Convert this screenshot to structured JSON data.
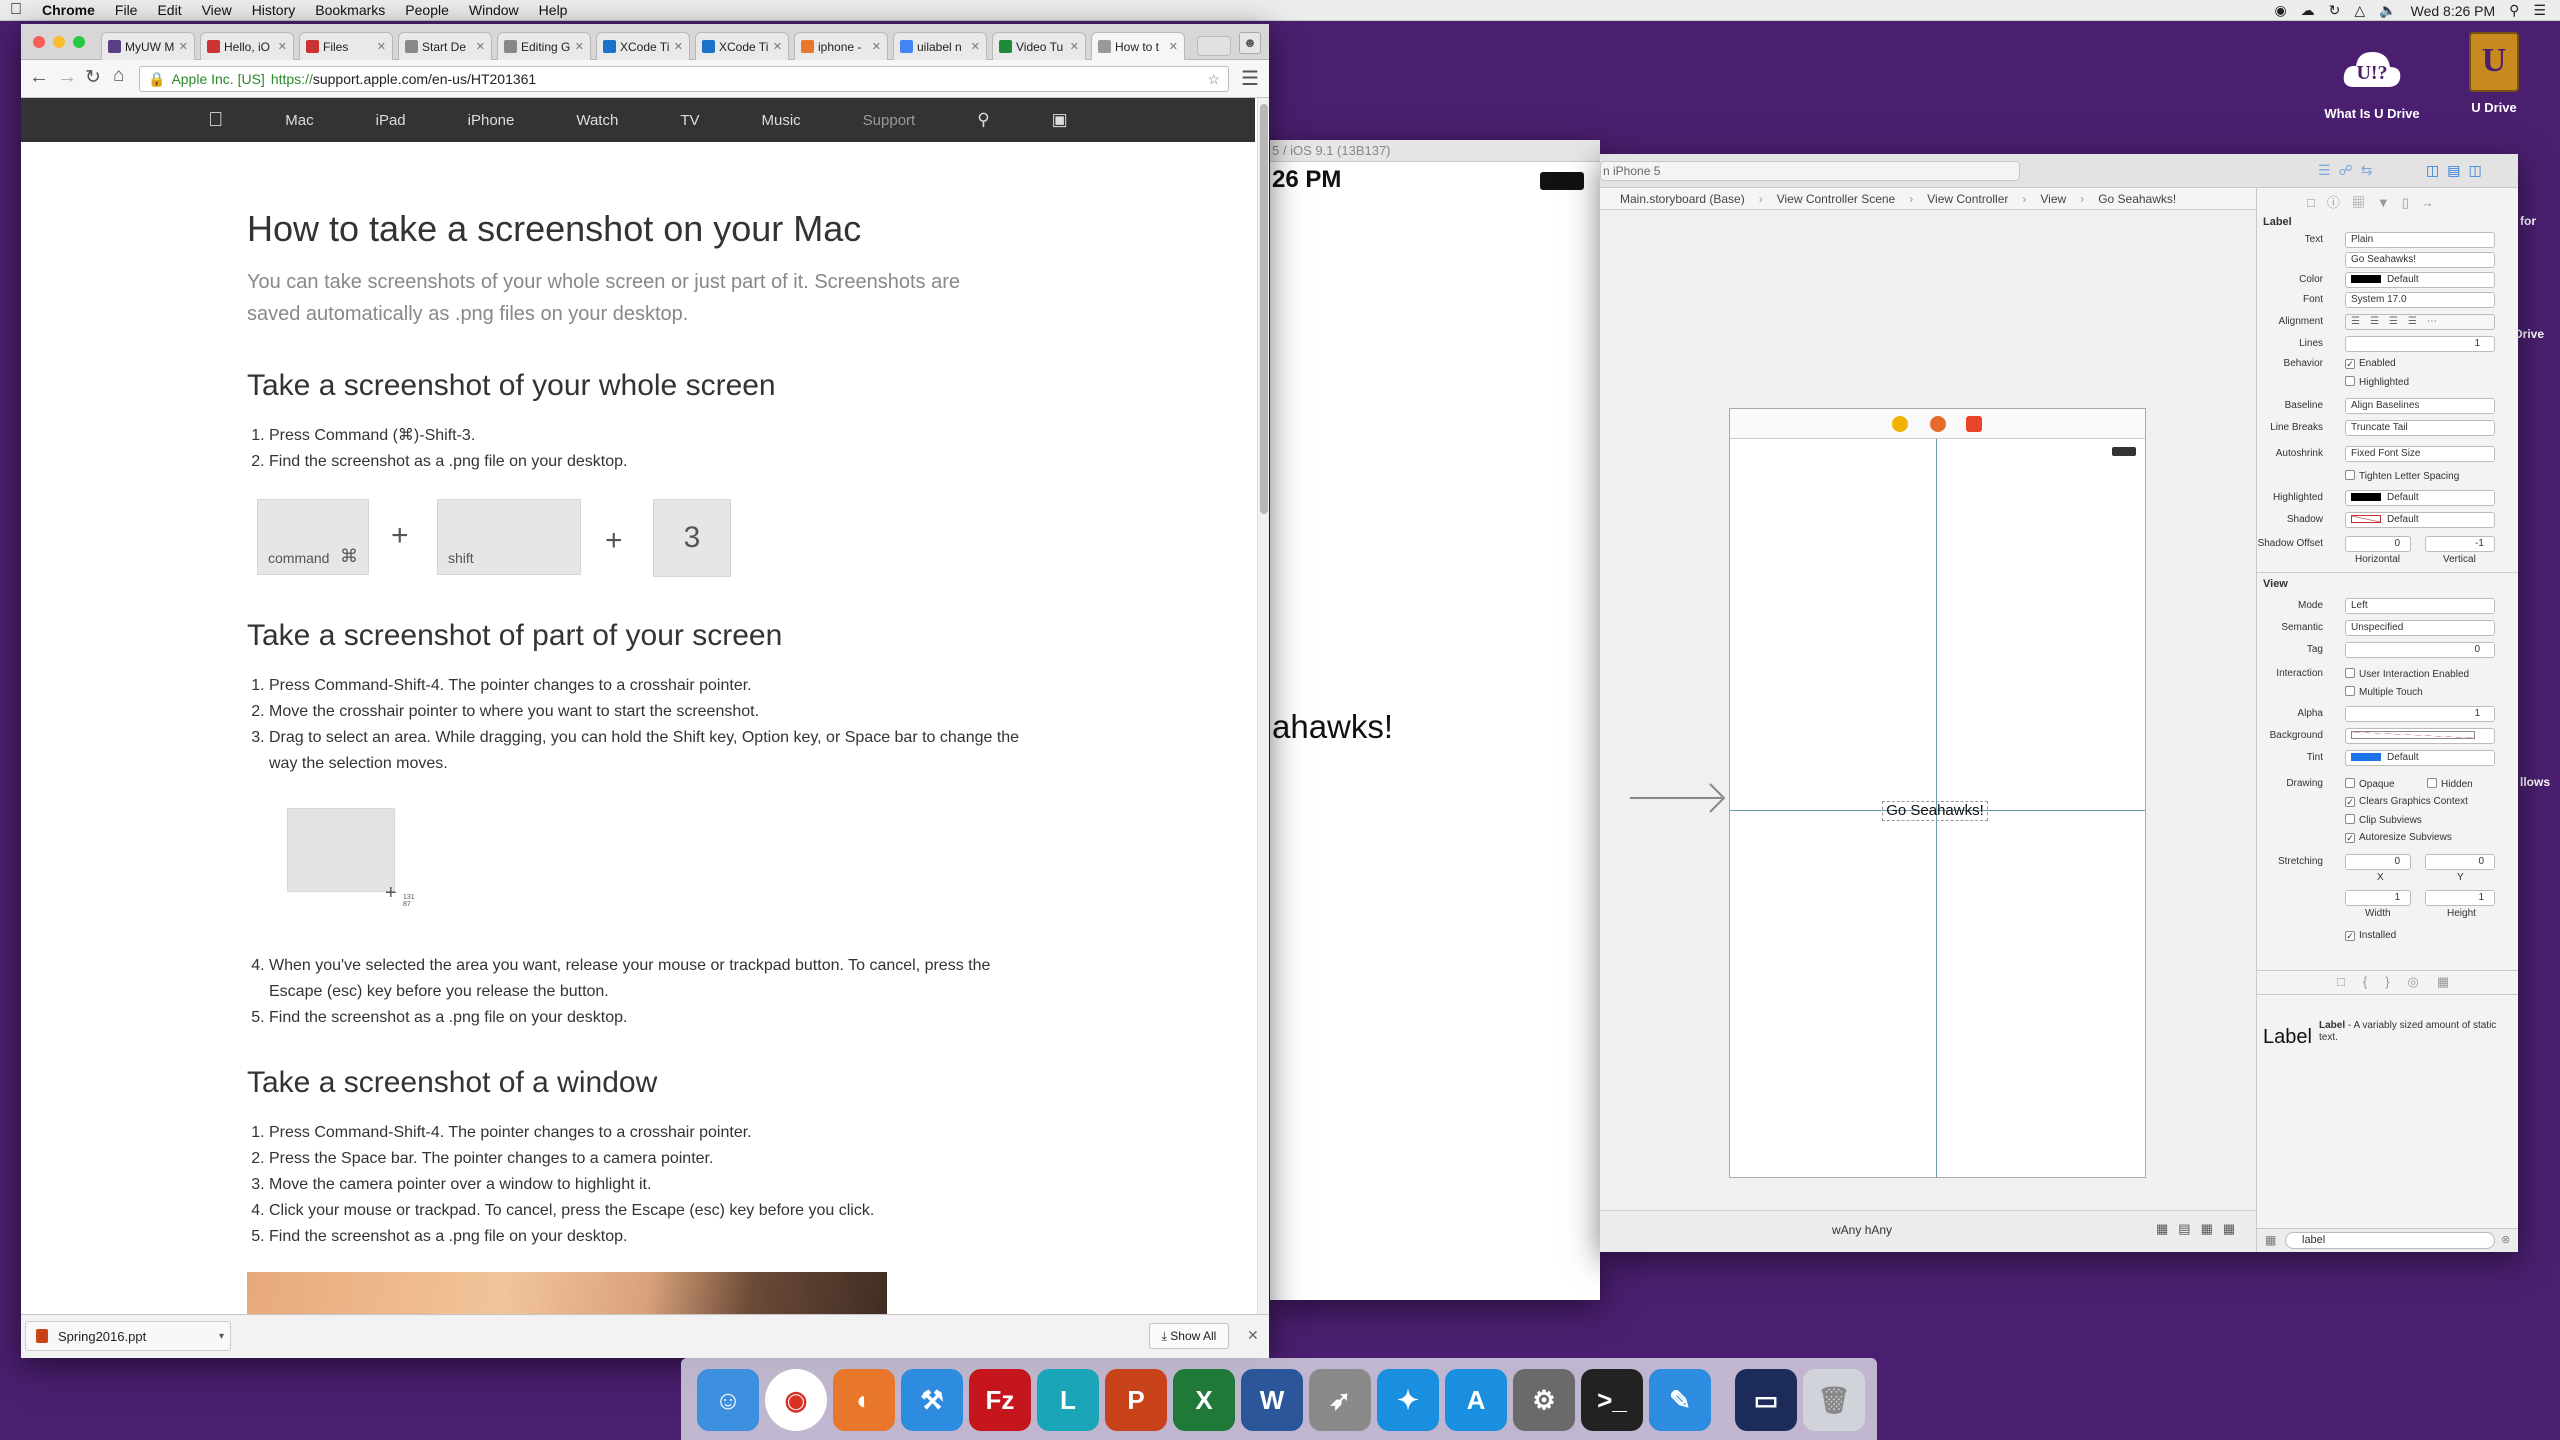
{
  "menubar": {
    "app": "Chrome",
    "items": [
      "File",
      "Edit",
      "View",
      "History",
      "Bookmarks",
      "People",
      "Window",
      "Help"
    ],
    "clock": "Wed 8:26 PM"
  },
  "desktop": {
    "icons": [
      {
        "label": "What Is U Drive",
        "icon": "cloud-u-icon"
      },
      {
        "label": "U Drive",
        "icon": "u-drive-icon"
      }
    ],
    "peek_labels": [
      "for",
      "Drive",
      "llows"
    ]
  },
  "chrome": {
    "tabs": [
      {
        "label": "MyUW M",
        "color": "#5b3f86"
      },
      {
        "label": "Hello, iO",
        "color": "#cc3333"
      },
      {
        "label": "Files",
        "color": "#cc3333"
      },
      {
        "label": "Start De",
        "color": "#888888"
      },
      {
        "label": "Editing G",
        "color": "#888888"
      },
      {
        "label": "XCode Ti",
        "color": "#1a73c8"
      },
      {
        "label": "XCode Ti",
        "color": "#1a73c8"
      },
      {
        "label": "iphone -",
        "color": "#e8762b"
      },
      {
        "label": "uilabel n",
        "color": "#4285f4"
      },
      {
        "label": "Video Tu",
        "color": "#1f8a3a"
      },
      {
        "label": "How to t",
        "color": "#999999"
      }
    ],
    "omnibox": {
      "ev_label": "Apple Inc. [US]",
      "scheme": "https://",
      "url": "support.apple.com/en-us/HT201361"
    },
    "nav": [
      "Mac",
      "iPad",
      "iPhone",
      "Watch",
      "TV",
      "Music",
      "Support"
    ],
    "download": {
      "file": "Spring2016.ppt",
      "show_all": "Show All"
    }
  },
  "article": {
    "title": "How to take a screenshot on your Mac",
    "intro": "You can take screenshots of your whole screen or just part of it. Screenshots are saved automatically as .png files on your desktop.",
    "sections": [
      {
        "heading": "Take a screenshot of your whole screen",
        "steps": [
          "Press Command (⌘)-Shift-3.",
          "Find the screenshot as a .png file on your desktop."
        ]
      },
      {
        "heading": "Take a screenshot of part of your screen",
        "steps": [
          "Press Command-Shift-4. The pointer changes to a crosshair pointer.",
          "Move the crosshair pointer to where you want to start the screenshot.",
          "Drag to select an area. While dragging, you can hold the Shift key, Option key, or Space bar to change the way the selection moves."
        ],
        "steps_after": [
          "When you've selected the area you want, release your mouse or trackpad button. To cancel, press the Escape (esc) key before you release the button.",
          "Find the screenshot as a .png file on your desktop."
        ]
      },
      {
        "heading": "Take a screenshot of a window",
        "steps": [
          "Press Command-Shift-4. The pointer changes to a crosshair pointer.",
          "Press the Space bar. The pointer changes to a camera pointer.",
          "Move the camera pointer over a window to highlight it.",
          "Click your mouse or trackpad. To cancel, press the Escape (esc) key before you click.",
          "Find the screenshot as a .png file on your desktop."
        ]
      }
    ],
    "keys": {
      "command": "command",
      "command_symbol": "⌘",
      "shift": "shift",
      "three": "3",
      "plus": "+"
    },
    "crosshair_coords": "131\n87"
  },
  "simulator": {
    "title": "5 / iOS 9.1 (13B137)",
    "time": "26 PM",
    "label_text": "ahawks!"
  },
  "xcode": {
    "device": "n iPhone 5",
    "jumpbar": [
      "Main.storyboard (Base)",
      "View Controller Scene",
      "View Controller",
      "View",
      "Go Seahawks!"
    ],
    "canvas_label": "Go Seahawks!",
    "size_class": {
      "w": "Any",
      "h": "Any"
    },
    "inspector": {
      "label_section": "Label",
      "text_label": "Text",
      "text_value": "Plain",
      "text_content": "Go Seahawks!",
      "color_label": "Color",
      "color_value": "Default",
      "font_label": "Font",
      "font_value": "System 17.0",
      "alignment_label": "Alignment",
      "lines_label": "Lines",
      "lines_value": "1",
      "behavior_label": "Behavior",
      "enabled": "Enabled",
      "highlighted": "Highlighted",
      "baseline_label": "Baseline",
      "baseline_value": "Align Baselines",
      "linebreaks_label": "Line Breaks",
      "linebreaks_value": "Truncate Tail",
      "autoshrink_label": "Autoshrink",
      "autoshrink_value": "Fixed Font Size",
      "tighten": "Tighten Letter Spacing",
      "highlighted_label": "Highlighted",
      "highlighted_value": "Default",
      "shadow_label": "Shadow",
      "shadow_value": "Default",
      "shadow_offset_label": "Shadow Offset",
      "shadow_h": "0",
      "shadow_v": "-1",
      "horizontal": "Horizontal",
      "vertical": "Vertical",
      "view_section": "View",
      "mode_label": "Mode",
      "mode_value": "Left",
      "semantic_label": "Semantic",
      "semantic_value": "Unspecified",
      "tag_label": "Tag",
      "tag_value": "0",
      "interaction_label": "Interaction",
      "user_interaction": "User Interaction Enabled",
      "multiple_touch": "Multiple Touch",
      "alpha_label": "Alpha",
      "alpha_value": "1",
      "background_label": "Background",
      "tint_label": "Tint",
      "tint_value": "Default",
      "drawing_label": "Drawing",
      "opaque": "Opaque",
      "hidden": "Hidden",
      "clears": "Clears Graphics Context",
      "clip": "Clip Subviews",
      "autoresize": "Autoresize Subviews",
      "stretching_label": "Stretching",
      "stretch_x": "0",
      "stretch_y": "0",
      "x": "X",
      "y": "Y",
      "stretch_w": "1",
      "stretch_h": "1",
      "width": "Width",
      "height": "Height",
      "installed": "Installed",
      "library_title": "Label",
      "library_name": "Label",
      "library_desc": "- A variably sized amount of static text.",
      "filter_value": "label"
    },
    "colors": {
      "text": "#000000",
      "shadow": "#c03030",
      "tint": "#1a73e8"
    }
  },
  "dock": {
    "apps": [
      {
        "name": "Finder",
        "icon": "finder-icon",
        "color": "#3d8fe0"
      },
      {
        "name": "Chrome",
        "icon": "chrome-icon",
        "color": "#ffffff"
      },
      {
        "name": "Firefox",
        "icon": "firefox-icon",
        "color": "#e8762b"
      },
      {
        "name": "Xcode",
        "icon": "xcode-icon",
        "color": "#2d8ce0"
      },
      {
        "name": "FileZilla",
        "icon": "filezilla-icon",
        "color": "#c4161c"
      },
      {
        "name": "L",
        "icon": "lync-icon",
        "color": "#1aa5b8"
      },
      {
        "name": "PowerPoint",
        "icon": "powerpoint-icon",
        "color": "#c8421a"
      },
      {
        "name": "Excel",
        "icon": "excel-icon",
        "color": "#1f7a3a"
      },
      {
        "name": "Word",
        "icon": "word-icon",
        "color": "#2b579a"
      },
      {
        "name": "Launchpad",
        "icon": "rocket-icon",
        "color": "#8a8a8a"
      },
      {
        "name": "Safari",
        "icon": "safari-icon",
        "color": "#1a8fe0"
      },
      {
        "name": "App Store",
        "icon": "appstore-icon",
        "color": "#1a8fe0"
      },
      {
        "name": "System Preferences",
        "icon": "gear-icon",
        "color": "#6a6a6a"
      },
      {
        "name": "Terminal",
        "icon": "terminal-icon",
        "color": "#222222"
      },
      {
        "name": "Xcode Tools",
        "icon": "instruments-icon",
        "color": "#2d8ce0"
      },
      {
        "name": "Screen",
        "icon": "screen-icon",
        "color": "#1d2b5a"
      },
      {
        "name": "Trash",
        "icon": "trash-icon",
        "color": "#d0d4da"
      }
    ]
  }
}
